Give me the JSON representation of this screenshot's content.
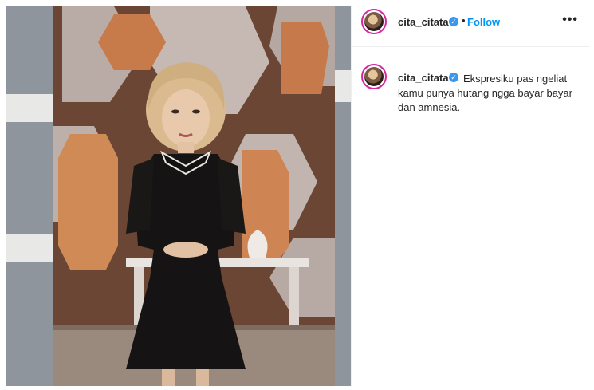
{
  "post": {
    "username": "cita_citata",
    "follow_label": "Follow",
    "separator": "•",
    "more_icon": "more-horizontal-icon",
    "verified_icon": "verified-badge-icon",
    "caption": {
      "username": "cita_citata",
      "text": "Ekspresiku pas ngeliat kamu punya hutang ngga bayar bayar dan amnesia."
    },
    "colors": {
      "follow": "#0095f6",
      "verified": "#3897f0",
      "avatar_ring": "#d6249f"
    }
  }
}
